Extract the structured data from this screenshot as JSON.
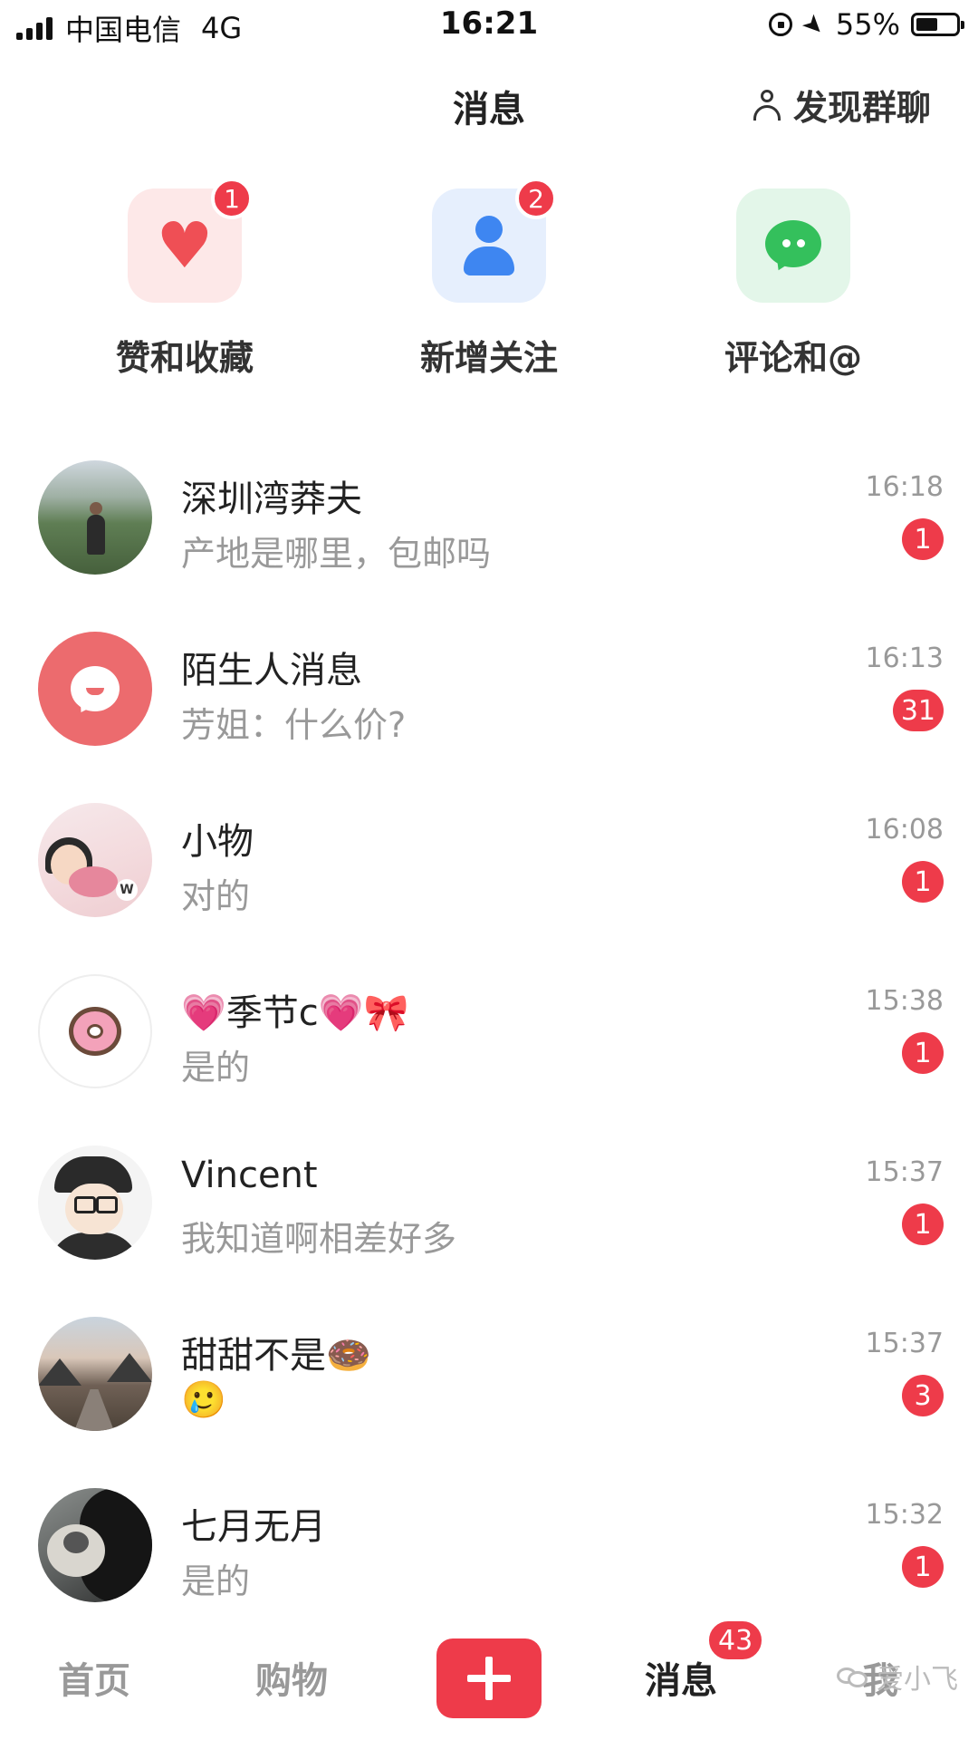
{
  "status_bar": {
    "carrier": "中国电信",
    "network": "4G",
    "time": "16:21",
    "battery": "55%",
    "battery_level": 0.55
  },
  "header": {
    "title": "消息",
    "discover_label": "发现群聊",
    "discover_icon": "person-outline-icon"
  },
  "shortcuts": [
    {
      "label": "赞和收藏",
      "badge": "1",
      "icon": "heart-icon",
      "bg": "#fde8e8"
    },
    {
      "label": "新增关注",
      "badge": "2",
      "icon": "person-icon",
      "bg": "#e6effd"
    },
    {
      "label": "评论和@",
      "badge": "",
      "icon": "chat-bubble-icon",
      "bg": "#e3f6e9"
    }
  ],
  "conversations": [
    {
      "name": "深圳湾莽夫",
      "message": "产地是哪里，包邮吗",
      "time": "16:18",
      "unread": "1"
    },
    {
      "name": "陌生人消息",
      "message": "芳姐：什么价?",
      "time": "16:13",
      "unread": "31"
    },
    {
      "name": "小物",
      "message": "对的",
      "time": "16:08",
      "unread": "1"
    },
    {
      "name_prefix": "💗",
      "name": "季节c",
      "name_suffix": "💗🎀",
      "message": "是的",
      "time": "15:38",
      "unread": "1"
    },
    {
      "name": "Vincent",
      "message": "我知道啊相差好多",
      "time": "15:37",
      "unread": "1"
    },
    {
      "name": "甜甜不是",
      "name_suffix": "🍩",
      "message": "🥲",
      "time": "15:37",
      "unread": "3"
    },
    {
      "name": "七月无月",
      "message": "是的",
      "time": "15:32",
      "unread": "1"
    }
  ],
  "bottom_nav": {
    "home": "首页",
    "shop": "购物",
    "messages": "消息",
    "messages_badge": "43",
    "me": "我",
    "watermark": "爱小飞"
  },
  "colors": {
    "accent": "#ee3b4a",
    "heart": "#ef4f55",
    "person": "#3e86f1",
    "chat": "#34c05c"
  }
}
